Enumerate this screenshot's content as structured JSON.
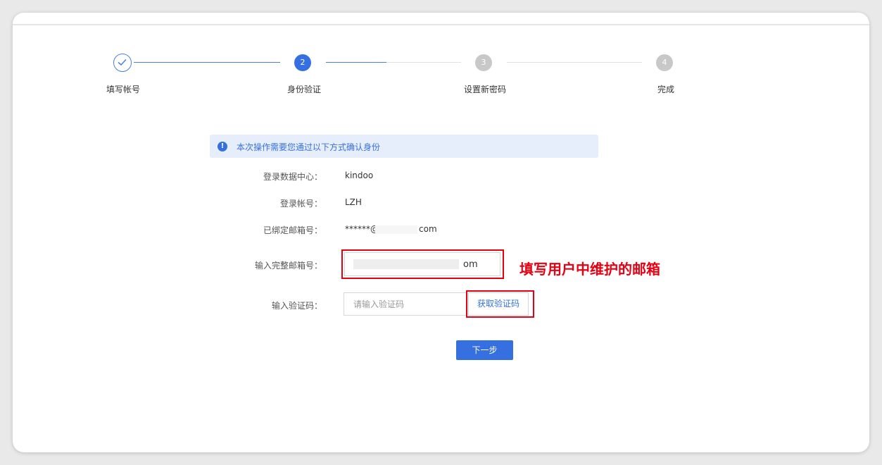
{
  "steps": [
    {
      "label": "填写帐号",
      "number": "1",
      "state": "done"
    },
    {
      "label": "身份验证",
      "number": "2",
      "state": "active"
    },
    {
      "label": "设置新密码",
      "number": "3",
      "state": "todo"
    },
    {
      "label": "完成",
      "number": "4",
      "state": "todo"
    }
  ],
  "notice": {
    "icon": "info-icon",
    "text": "本次操作需要您通过以下方式确认身份"
  },
  "form": {
    "datacenter": {
      "label": "登录数据中心：",
      "value": "kindoo"
    },
    "account": {
      "label": "登录帐号：",
      "value": "LZH"
    },
    "bound_email": {
      "label": "已绑定邮箱号：",
      "prefix": "******@",
      "suffix": "com"
    },
    "full_email": {
      "label": "输入完整邮箱号：",
      "value_tail": "om"
    },
    "code": {
      "label": "输入验证码：",
      "placeholder": "请输入验证码",
      "button": "获取验证码"
    },
    "next_button": "下一步"
  },
  "annotation": {
    "text": "填写用户中维护的邮箱",
    "color": "#e60012"
  },
  "colors": {
    "accent": "#3670e0",
    "annotation_red": "#e60012",
    "step_todo": "#c8c8c8"
  }
}
